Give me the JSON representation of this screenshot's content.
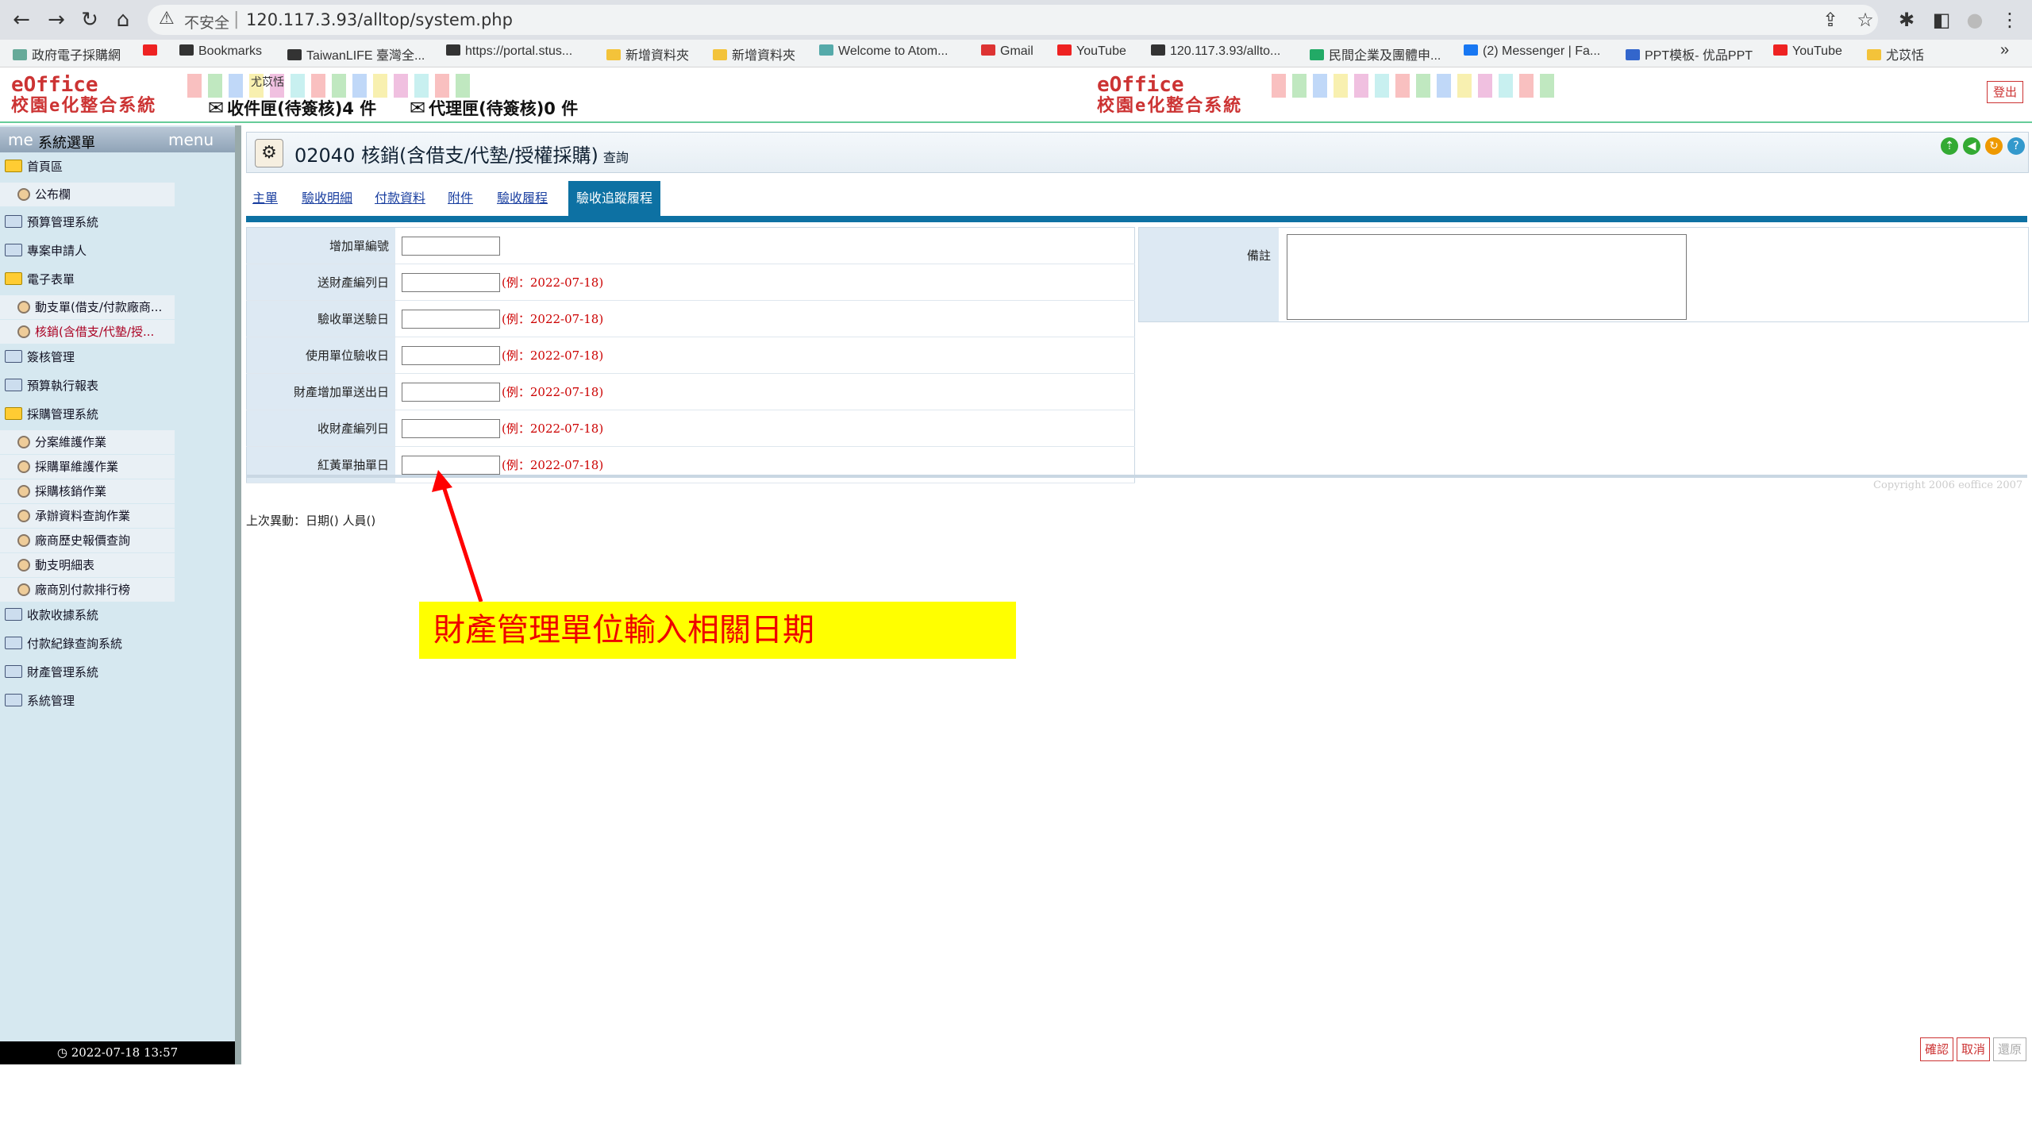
{
  "browser": {
    "insecure_label": "不安全",
    "url": "120.117.3.93/alltop/system.php",
    "bookmarks": [
      {
        "label": "政府電子採購網",
        "color": "#6a9"
      },
      {
        "label": "",
        "color": "#e22"
      },
      {
        "label": "Bookmarks",
        "color": "#333"
      },
      {
        "label": "TaiwanLIFE 臺灣全...",
        "color": "#333"
      },
      {
        "label": "https://portal.stus...",
        "color": "#333"
      },
      {
        "label": "新增資料夾",
        "color": "#f3c33a"
      },
      {
        "label": "新增資料夾",
        "color": "#f3c33a"
      },
      {
        "label": "Welcome to Atom...",
        "color": "#5aa"
      },
      {
        "label": "Gmail",
        "color": "#d33"
      },
      {
        "label": "YouTube",
        "color": "#e22"
      },
      {
        "label": "120.117.3.93/allto...",
        "color": "#333"
      },
      {
        "label": "民間企業及團體申...",
        "color": "#2a6"
      },
      {
        "label": "(2) Messenger | Fa...",
        "color": "#1877f2"
      },
      {
        "label": "PPT模板- 优品PPT",
        "color": "#36c"
      },
      {
        "label": "YouTube",
        "color": "#e22"
      },
      {
        "label": "尤苡恬",
        "color": "#f3c33a"
      }
    ],
    "overflow": "»"
  },
  "header": {
    "logo_line1": "eOffice",
    "logo_line2": "校園e化整合系統",
    "user_name": "尤苡恬",
    "inbox": "收件匣(待簽核)4 件",
    "proxy_box": "代理匣(待簽核)0 件",
    "logout": "登出"
  },
  "sidebar": {
    "head_left": "me",
    "head_title": "系統選單",
    "head_right": "menu",
    "items": [
      {
        "label": "首頁區",
        "type": "folder-open"
      },
      {
        "label": "公布欄",
        "type": "sub"
      },
      {
        "label": "預算管理系統",
        "type": "folder"
      },
      {
        "label": "專案申請人",
        "type": "folder"
      },
      {
        "label": "電子表單",
        "type": "folder-open"
      },
      {
        "label": "動支單(借支/付款廠商...",
        "type": "sub"
      },
      {
        "label": "核銷(含借支/代墊/授...",
        "type": "sub",
        "active": true
      },
      {
        "label": "簽核管理",
        "type": "folder"
      },
      {
        "label": "預算執行報表",
        "type": "folder"
      },
      {
        "label": "採購管理系統",
        "type": "folder-open"
      },
      {
        "label": "分案維護作業",
        "type": "sub"
      },
      {
        "label": "採購單維護作業",
        "type": "sub"
      },
      {
        "label": "採購核銷作業",
        "type": "sub"
      },
      {
        "label": "承辦資料查詢作業",
        "type": "sub"
      },
      {
        "label": "廠商歷史報價查詢",
        "type": "sub"
      },
      {
        "label": "動支明細表",
        "type": "sub"
      },
      {
        "label": "廠商別付款排行榜",
        "type": "sub"
      },
      {
        "label": "收款收據系統",
        "type": "folder"
      },
      {
        "label": "付款紀錄查詢系統",
        "type": "folder"
      },
      {
        "label": "財產管理系統",
        "type": "folder"
      },
      {
        "label": "系統管理",
        "type": "folder"
      }
    ],
    "clock": "2022-07-18 13:57"
  },
  "main": {
    "title": "02040 核銷(含借支/代墊/授權採購)",
    "title_mode": "查詢",
    "tabs": [
      "主單",
      "驗收明細",
      "付款資料",
      "附件",
      "驗收履程",
      "驗收追蹤履程"
    ],
    "active_tab": 5,
    "fields": [
      {
        "label": "增加單編號",
        "hint": ""
      },
      {
        "label": "送財產編列日",
        "hint": "(例：2022-07-18)"
      },
      {
        "label": "驗收單送驗日",
        "hint": "(例：2022-07-18)"
      },
      {
        "label": "使用單位驗收日",
        "hint": "(例：2022-07-18)"
      },
      {
        "label": "財產增加單送出日",
        "hint": "(例：2022-07-18)"
      },
      {
        "label": "收財產編列日",
        "hint": "(例：2022-07-18)"
      },
      {
        "label": "紅黃單抽單日",
        "hint": "(例：2022-07-18)"
      }
    ],
    "remark_label": "備註",
    "copyright": "Copyright 2006 eoffice 2007",
    "last_modified": "上次異動：日期() 人員()",
    "annotation": "財產管理單位輸入相關日期",
    "buttons": {
      "confirm": "確認",
      "cancel": "取消",
      "restore": "還原"
    }
  }
}
